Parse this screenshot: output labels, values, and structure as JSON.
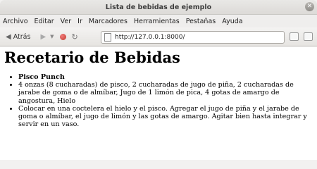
{
  "window": {
    "title": "Lista de bebidas de ejemplo"
  },
  "menu": [
    "Archivo",
    "Editar",
    "Ver",
    "Ir",
    "Marcadores",
    "Herramientas",
    "Pestañas",
    "Ayuda"
  ],
  "nav": {
    "back_label": "Atrás",
    "url": "http://127.0.0.1:8000/"
  },
  "page": {
    "heading": "Recetario de Bebidas",
    "items": [
      "Pisco Punch",
      "4 onzas (8 cucharadas) de pisco, 2 cucharadas de jugo de piña, 2 cucharadas de jarabe de goma o de almíbar, Jugo de 1 limón de pica, 4 gotas de amargo de angostura, Hielo",
      "Colocar en una coctelera el hielo y el pisco. Agregar el jugo de piña y el jarabe de goma o almíbar, el jugo de limón y las gotas de amargo. Agitar bien hasta integrar y servir en un vaso."
    ]
  }
}
